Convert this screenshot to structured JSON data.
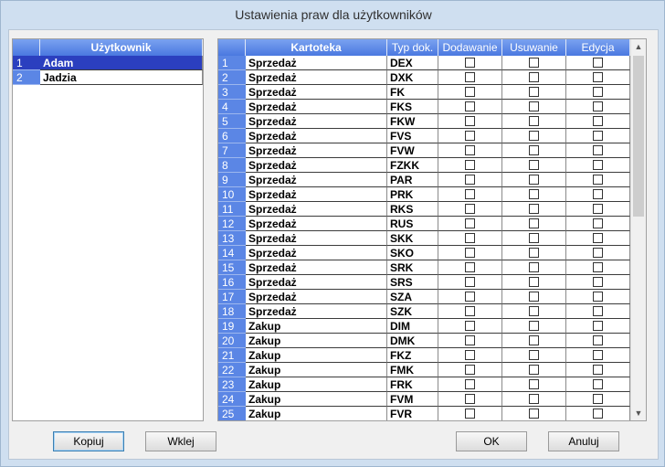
{
  "window": {
    "title": "Ustawienia praw dla użytkowników"
  },
  "users": {
    "header": "Użytkownik",
    "rows": [
      {
        "n": "1",
        "name": "Adam",
        "selected": true
      },
      {
        "n": "2",
        "name": "Jadzia",
        "selected": false
      }
    ]
  },
  "rights": {
    "headers": {
      "kartoteka": "Kartoteka",
      "typ": "Typ dok.",
      "dodawanie": "Dodawanie",
      "usuwanie": "Usuwanie",
      "edycja": "Edycja"
    },
    "rows": [
      {
        "n": "1",
        "kartoteka": "Sprzedaż",
        "typ": "DEX"
      },
      {
        "n": "2",
        "kartoteka": "Sprzedaż",
        "typ": "DXK"
      },
      {
        "n": "3",
        "kartoteka": "Sprzedaż",
        "typ": "FK"
      },
      {
        "n": "4",
        "kartoteka": "Sprzedaż",
        "typ": "FKS"
      },
      {
        "n": "5",
        "kartoteka": "Sprzedaż",
        "typ": "FKW"
      },
      {
        "n": "6",
        "kartoteka": "Sprzedaż",
        "typ": "FVS"
      },
      {
        "n": "7",
        "kartoteka": "Sprzedaż",
        "typ": "FVW"
      },
      {
        "n": "8",
        "kartoteka": "Sprzedaż",
        "typ": "FZKK"
      },
      {
        "n": "9",
        "kartoteka": "Sprzedaż",
        "typ": "PAR"
      },
      {
        "n": "10",
        "kartoteka": "Sprzedaż",
        "typ": "PRK"
      },
      {
        "n": "11",
        "kartoteka": "Sprzedaż",
        "typ": "RKS"
      },
      {
        "n": "12",
        "kartoteka": "Sprzedaż",
        "typ": "RUS"
      },
      {
        "n": "13",
        "kartoteka": "Sprzedaż",
        "typ": "SKK"
      },
      {
        "n": "14",
        "kartoteka": "Sprzedaż",
        "typ": "SKO"
      },
      {
        "n": "15",
        "kartoteka": "Sprzedaż",
        "typ": "SRK"
      },
      {
        "n": "16",
        "kartoteka": "Sprzedaż",
        "typ": "SRS"
      },
      {
        "n": "17",
        "kartoteka": "Sprzedaż",
        "typ": "SZA"
      },
      {
        "n": "18",
        "kartoteka": "Sprzedaż",
        "typ": "SZK"
      },
      {
        "n": "19",
        "kartoteka": "Zakup",
        "typ": "DIM"
      },
      {
        "n": "20",
        "kartoteka": "Zakup",
        "typ": "DMK"
      },
      {
        "n": "21",
        "kartoteka": "Zakup",
        "typ": "FKZ"
      },
      {
        "n": "22",
        "kartoteka": "Zakup",
        "typ": "FMK"
      },
      {
        "n": "23",
        "kartoteka": "Zakup",
        "typ": "FRK"
      },
      {
        "n": "24",
        "kartoteka": "Zakup",
        "typ": "FVM"
      },
      {
        "n": "25",
        "kartoteka": "Zakup",
        "typ": "FVR"
      }
    ]
  },
  "buttons": {
    "kopiuj": "Kopiuj",
    "wklej": "Wklej",
    "ok": "OK",
    "anuluj": "Anuluj"
  }
}
